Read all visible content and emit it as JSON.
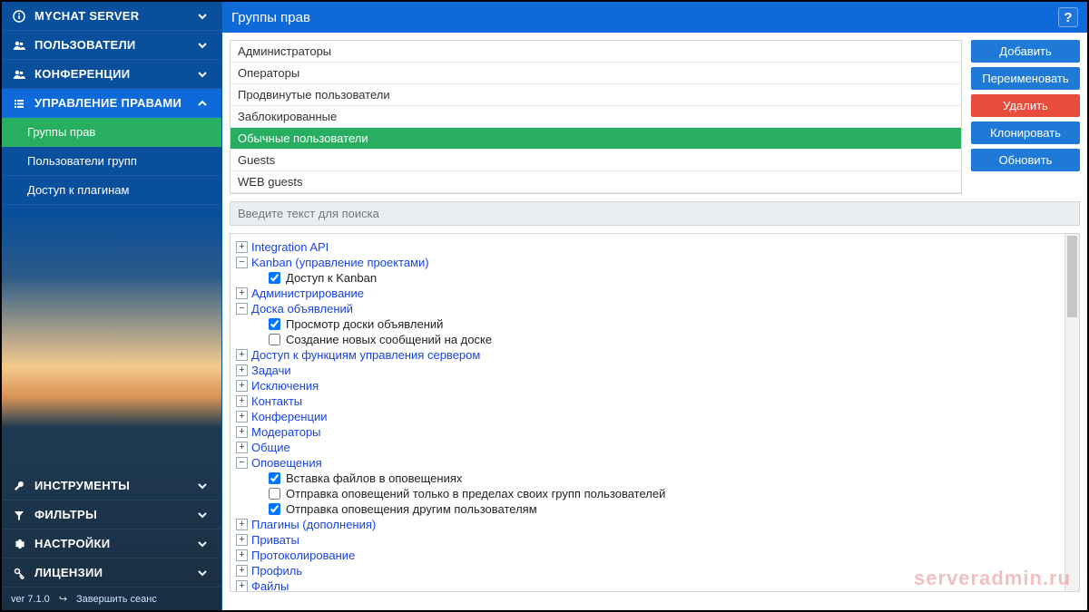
{
  "sidebar": {
    "top_items": [
      {
        "icon": "info",
        "label": "MYCHAT SERVER",
        "chev": "down"
      },
      {
        "icon": "users",
        "label": "ПОЛЬЗОВАТЕЛИ",
        "chev": "down"
      },
      {
        "icon": "users",
        "label": "КОНФЕРЕНЦИИ",
        "chev": "down"
      },
      {
        "icon": "list",
        "label": "УПРАВЛЕНИЕ ПРАВАМИ",
        "chev": "up",
        "active": true
      }
    ],
    "sub_items": [
      {
        "label": "Группы прав",
        "active": true
      },
      {
        "label": "Пользователи групп"
      },
      {
        "label": "Доступ к плагинам"
      }
    ],
    "bottom_items": [
      {
        "icon": "wrench",
        "label": "ИНСТРУМЕНТЫ",
        "chev": "down"
      },
      {
        "icon": "filter",
        "label": "ФИЛЬТРЫ",
        "chev": "down"
      },
      {
        "icon": "gear",
        "label": "НАСТРОЙКИ",
        "chev": "down"
      },
      {
        "icon": "key",
        "label": "ЛИЦЕНЗИИ",
        "chev": "down"
      }
    ],
    "footer": {
      "version": "ver 7.1.0",
      "logout": "Завершить сеанс"
    }
  },
  "header": {
    "title": "Группы прав",
    "help": "?"
  },
  "groups": [
    {
      "name": "Администраторы"
    },
    {
      "name": "Операторы"
    },
    {
      "name": "Продвинутые пользователи"
    },
    {
      "name": "Заблокированные"
    },
    {
      "name": "Обычные пользователи",
      "active": true
    },
    {
      "name": "Guests"
    },
    {
      "name": "WEB guests"
    }
  ],
  "actions": {
    "add": "Добавить",
    "rename": "Переименовать",
    "delete": "Удалить",
    "clone": "Клонировать",
    "refresh": "Обновить"
  },
  "search": {
    "placeholder": "Введите текст для поиска"
  },
  "tree": [
    {
      "type": "node",
      "toggle": "+",
      "label": "Integration API"
    },
    {
      "type": "node",
      "toggle": "−",
      "label": "Kanban (управление проектами)"
    },
    {
      "type": "check",
      "checked": true,
      "label": "Доступ к Kanban"
    },
    {
      "type": "node",
      "toggle": "+",
      "label": "Администрирование"
    },
    {
      "type": "node",
      "toggle": "−",
      "label": "Доска объявлений"
    },
    {
      "type": "check",
      "checked": true,
      "label": "Просмотр доски объявлений"
    },
    {
      "type": "check",
      "checked": false,
      "label": "Создание новых сообщений на доске"
    },
    {
      "type": "node",
      "toggle": "+",
      "label": "Доступ к функциям управления сервером"
    },
    {
      "type": "node",
      "toggle": "+",
      "label": "Задачи"
    },
    {
      "type": "node",
      "toggle": "+",
      "label": "Исключения"
    },
    {
      "type": "node",
      "toggle": "+",
      "label": "Контакты"
    },
    {
      "type": "node",
      "toggle": "+",
      "label": "Конференции"
    },
    {
      "type": "node",
      "toggle": "+",
      "label": "Модераторы"
    },
    {
      "type": "node",
      "toggle": "+",
      "label": "Общие"
    },
    {
      "type": "node",
      "toggle": "−",
      "label": "Оповещения"
    },
    {
      "type": "check",
      "checked": true,
      "label": "Вставка файлов в оповещениях"
    },
    {
      "type": "check",
      "checked": false,
      "label": "Отправка оповещений только в пределах своих групп пользователей"
    },
    {
      "type": "check",
      "checked": true,
      "label": "Отправка оповещения другим пользователям"
    },
    {
      "type": "node",
      "toggle": "+",
      "label": "Плагины (дополнения)"
    },
    {
      "type": "node",
      "toggle": "+",
      "label": "Приваты"
    },
    {
      "type": "node",
      "toggle": "+",
      "label": "Протоколирование"
    },
    {
      "type": "node",
      "toggle": "+",
      "label": "Профиль"
    },
    {
      "type": "node",
      "toggle": "+",
      "label": "Файлы"
    }
  ],
  "watermark": "serveradmin.ru"
}
